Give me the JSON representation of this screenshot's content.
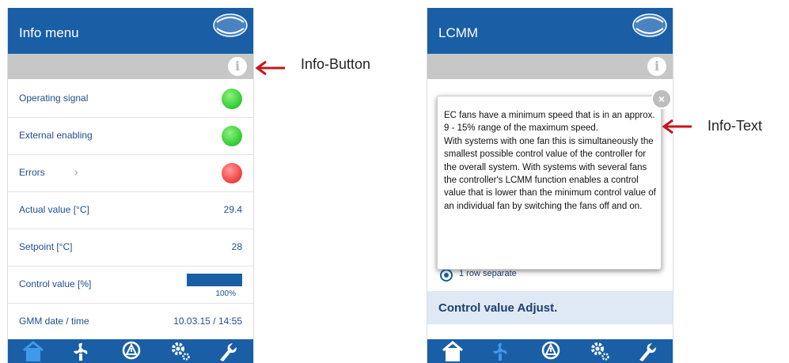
{
  "left_screen": {
    "title": "Info menu",
    "rows": [
      {
        "label": "Operating signal",
        "indicator": "green"
      },
      {
        "label": "External enabling",
        "indicator": "green"
      },
      {
        "label": "Errors",
        "indicator": "red"
      },
      {
        "label": "Actual value [°C]",
        "value": "29.4"
      },
      {
        "label": "Setpoint [°C]",
        "value": "28"
      },
      {
        "label": "Control value [%]",
        "progress_label": "100%",
        "progress_fraction": 1.0
      },
      {
        "label": "GMM date / time",
        "value": "10.03.15 / 14:55"
      }
    ],
    "tabs": [
      "home-icon",
      "fan-icon",
      "alarm-icon",
      "settings-icon",
      "service-icon"
    ]
  },
  "right_screen": {
    "title": "LCMM",
    "info_text": "EC fans have a minimum speed that is in an approx. 9 - 15% range of the maximum speed.\nWith systems with one fan this is simultaneously the smallest possible control value of the controller for the overall system. With systems with several fans the controller's LCMM function enables a control value that is lower than the minimum control value of an individual fan by switching the fans off and on.",
    "radio_label": "1 row separate",
    "section_title": "Control value Adjust."
  },
  "annotations": {
    "info_button": "Info-Button",
    "info_text": "Info-Text"
  },
  "colors": {
    "brand_blue": "#1a5ea6",
    "info_gray": "#c7c7c7",
    "ok_green": "#3ad13a",
    "error_red": "#f24a4a",
    "arrow_red": "#c4161c"
  }
}
